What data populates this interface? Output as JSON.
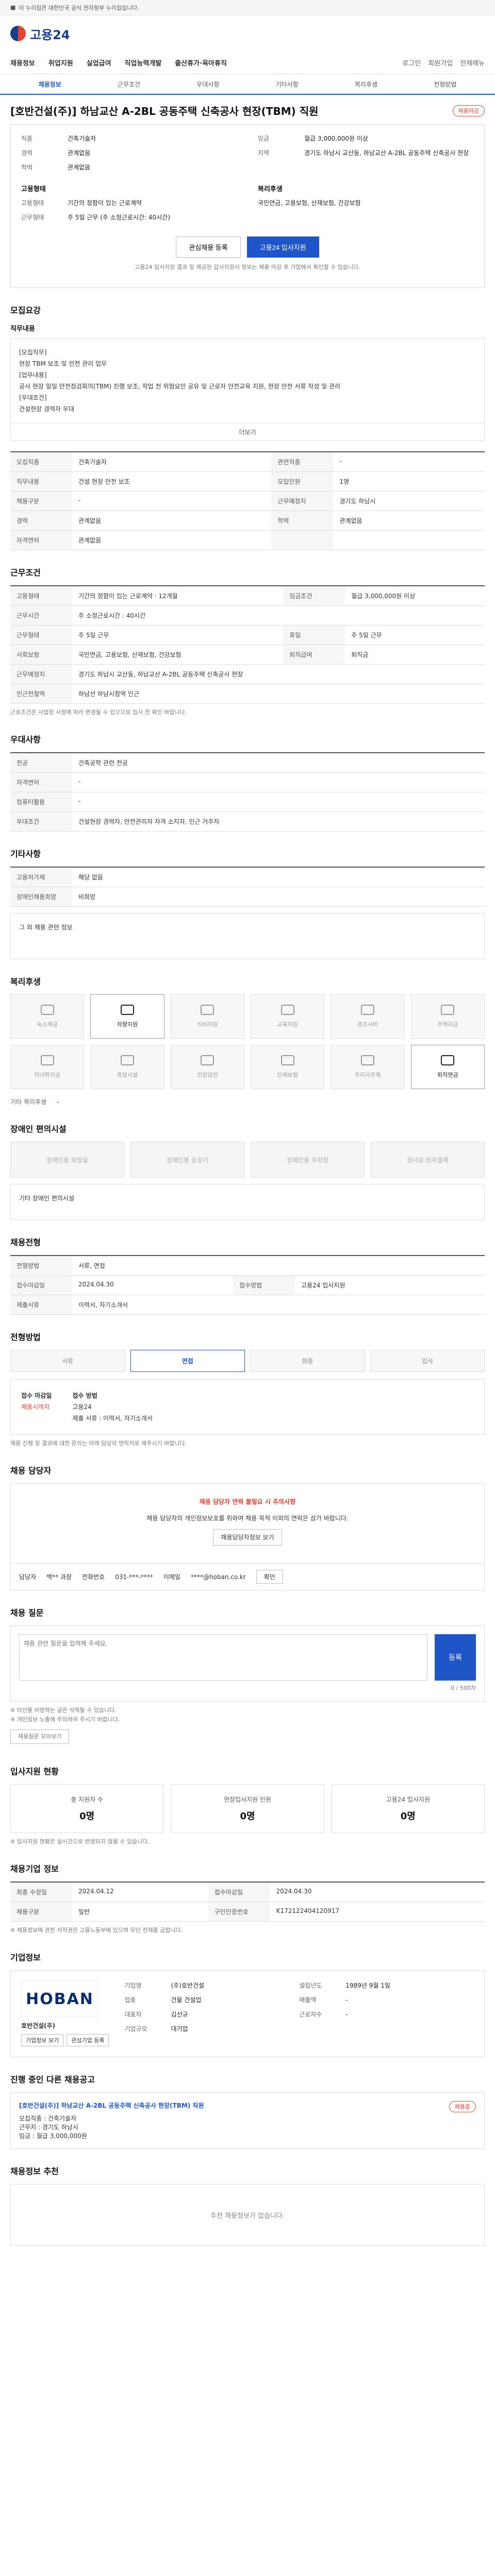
{
  "topbar": {
    "notice": "이 누리집은 대한민국 공식 전자정부 누리집입니다."
  },
  "header": {
    "logo_text": "고용24"
  },
  "gnb": {
    "items": [
      "채용정보",
      "취업지원",
      "실업급여",
      "직업능력개발",
      "출산휴가·육아휴직"
    ],
    "login": "로그인",
    "join": "회원가입",
    "menu": "전체메뉴"
  },
  "subtabs": [
    "채용정보",
    "근무조건",
    "우대사항",
    "기타사항",
    "복리후생",
    "전형방법"
  ],
  "job": {
    "title": "[호반건설(주)] 하남교산 A-2BL 공동주택 신축공사 현장(TBM) 직원",
    "badge": "채용마감",
    "left": [
      {
        "k": "직종",
        "v": "건축기술자"
      },
      {
        "k": "경력",
        "v": "관계없음"
      },
      {
        "k": "학력",
        "v": "관계없음"
      }
    ],
    "right": [
      {
        "k": "임금",
        "v": "월급 3,000,000원 이상"
      },
      {
        "k": "지역",
        "v": "경기도 하남시 교산동, 하남교산 A-2BL 공동주택 신축공사 현장"
      }
    ],
    "cond_title": "고용형태",
    "cond": [
      {
        "k": "고용형태",
        "v": "기간의 정함이 있는 근로계약"
      },
      {
        "k": "근무형태",
        "v": "주 5일 근무 (주 소정근로시간: 40시간)"
      }
    ],
    "benefit_title": "복리후생",
    "benefit": "국민연금, 고용보험, 산재보험, 건강보험",
    "scrap": "관심채용 등록",
    "apply": "고용24 입사지원",
    "note": "고용24 입사지원 결과 및 제공된 입사지원서 정보는 채용 마감 후 기업에서 확인할 수 있습니다."
  },
  "recruit": {
    "sec": "모집요강",
    "desc_title": "직무내용",
    "desc": "[모집직무]\n현장 TBM 보조 및 안전 관리 업무\n[업무내용]\n공사 현장 일일 안전점검회의(TBM) 진행 보조, 작업 전 위험요인 공유 및 근로자 안전교육 지원, 현장 안전 서류 작성 및 관리\n[우대조건]\n건설현장 경력자 우대",
    "more": "더보기",
    "rows": [
      {
        "k": "모집직종",
        "v": "건축기술자",
        "k2": "관련직종",
        "v2": "-"
      },
      {
        "k": "직무내용",
        "v": "건설 현장 안전 보조",
        "k2": "모집인원",
        "v2": "1명"
      },
      {
        "k": "채용구분",
        "v": "-",
        "k2": "근무예정지",
        "v2": "경기도 하남시"
      },
      {
        "k": "경력",
        "v": "관계없음",
        "k2": "학력",
        "v2": "관계없음"
      },
      {
        "k": "자격면허",
        "v": "관계없음",
        "k2": "",
        "v2": ""
      }
    ]
  },
  "work": {
    "sec": "근무조건",
    "rows": [
      {
        "k": "고용형태",
        "v": "기간의 정함이 있는 근로계약 · 12개월",
        "k2": "임금조건",
        "v2": "월급 3,000,000원 이상"
      },
      {
        "k": "근무시간",
        "v": "주 소정근로시간 : 40시간",
        "k2": "",
        "v2": ""
      },
      {
        "k": "근무형태",
        "v": "주 5일 근무",
        "k2": "휴일",
        "v2": "주 5일 근무"
      },
      {
        "k": "사회보험",
        "v": "국민연금, 고용보험, 산재보험, 건강보험",
        "k2": "퇴직급여",
        "v2": "퇴직금"
      },
      {
        "k": "근무예정지",
        "v": "경기도 하남시 교산동, 하남교산 A-2BL 공동주택 신축공사 현장",
        "k2": "",
        "v2": ""
      },
      {
        "k": "인근전철역",
        "v": "하남선 하남시청역 인근",
        "k2": "",
        "v2": ""
      }
    ],
    "note": "근로조건은 사업장 사정에 따라 변경될 수 있으므로 입사 전 확인 바랍니다."
  },
  "prefer": {
    "sec": "우대사항",
    "rows": [
      {
        "k": "전공",
        "v": "건축공학 관련 전공"
      },
      {
        "k": "자격면허",
        "v": "-"
      },
      {
        "k": "컴퓨터활용",
        "v": "-"
      },
      {
        "k": "우대조건",
        "v": "건설현장 경력자, 안전관리자 자격 소지자, 인근 거주자"
      }
    ]
  },
  "etc": {
    "sec": "기타사항",
    "rows": [
      {
        "k": "고용허가제",
        "v": "해당 없음"
      },
      {
        "k": "장애인채용희망",
        "v": "비희망"
      }
    ],
    "extra": "그 외 채용 관련 정보"
  },
  "welfare": {
    "sec": "복리후생",
    "items": [
      {
        "label": "숙소제공",
        "on": false
      },
      {
        "label": "차량지원",
        "on": true
      },
      {
        "label": "식비지원",
        "on": false
      },
      {
        "label": "교육지원",
        "on": false
      },
      {
        "label": "경조사비",
        "on": false
      },
      {
        "label": "주택자금",
        "on": false
      },
      {
        "label": "자녀학자금",
        "on": false
      },
      {
        "label": "휴양시설",
        "on": false
      },
      {
        "label": "건강검진",
        "on": false
      },
      {
        "label": "단체보험",
        "on": false
      },
      {
        "label": "우리사주제",
        "on": false
      },
      {
        "label": "퇴직연금",
        "on": true
      }
    ],
    "etc_label": "기타 복리후생",
    "etc_value": "-"
  },
  "disability": {
    "sec": "장애인 편의시설",
    "items": [
      "장애인용 화장실",
      "장애인용 승강기",
      "장애인용 주차장",
      "경사로·점자블록"
    ],
    "note": "기타 장애인 편의시설"
  },
  "hire": {
    "sec": "채용전형",
    "rows": [
      {
        "k": "전형방법",
        "v": "서류, 면접",
        "k2": "",
        "v2": ""
      },
      {
        "k": "접수마감일",
        "v": "2024.04.30",
        "k2": "접수방법",
        "v2": "고용24 입사지원"
      },
      {
        "k": "제출서류",
        "v": "이력서, 자기소개서",
        "k2": "",
        "v2": ""
      }
    ]
  },
  "process": {
    "sec": "전형방법",
    "steps": [
      "서류",
      "면접",
      "최종",
      "입사"
    ],
    "apply_title": "접수 마감일",
    "apply_value": "채용시까지",
    "method_title": "접수 방법",
    "method_value": "고용24",
    "docs": "제출 서류 : 이력서, 자기소개서",
    "note": "채용 진행 및 결과에 대한 문의는 아래 담당자 연락처로 해주시기 바랍니다."
  },
  "contact": {
    "sec": "채용 담당자",
    "warn": "채용 담당자 연락 불필요 시 주의사항",
    "text": "채용 담당자의 개인정보보호를 위하여 채용 목적 이외의 연락은 삼가 바랍니다.",
    "btn": "채용담당자정보 보기",
    "name_label": "담당자",
    "name": "백** 과장",
    "tel_label": "전화번호",
    "tel": "031-***-****",
    "email_label": "이메일",
    "email": "****@hoban.co.kr",
    "confirm": "확인"
  },
  "comment": {
    "sec": "채용 질문",
    "placeholder": "채용 관련 질문을 입력해 주세요.",
    "count": "0 / 500자",
    "submit": "등록",
    "notes": [
      "※ 타인을 비방하는 글은 삭제될 수 있습니다.",
      "※ 개인정보 노출에 주의하여 주시기 바랍니다."
    ],
    "more_btn": "채용질문 모아보기"
  },
  "status": {
    "sec": "입사지원 현황",
    "items": [
      {
        "label": "총 지원자 수",
        "value": "0명"
      },
      {
        "label": "현장입사지원 인원",
        "value": "0명"
      },
      {
        "label": "고용24 입사지원",
        "value": "0명"
      }
    ],
    "note": "※ 입사지원 현황은 실시간으로 반영되지 않을 수 있습니다."
  },
  "info": {
    "sec": "채용기업 정보",
    "rows": [
      {
        "k": "최종 수정일",
        "v": "2024.04.12",
        "k2": "접수마감일",
        "v2": "2024.04.30"
      },
      {
        "k": "채용구분",
        "v": "일반",
        "k2": "구인인증번호",
        "v2": "K172122404120917"
      }
    ],
    "note": "※ 채용정보에 관한 저작권은 고용노동부에 있으며 무단 전재를 금합니다."
  },
  "company": {
    "sec": "기업정보",
    "logo": "HOBAN",
    "name": "호반건설(주)",
    "rows": [
      {
        "k": "기업명",
        "v": "(주)호반건설",
        "k2": "설립년도",
        "v2": "1989년 9월 1일"
      },
      {
        "k": "업종",
        "v": "건물 건설업",
        "k2": "매출액",
        "v2": "-"
      },
      {
        "k": "대표자",
        "v": "김선규",
        "k2": "근로자수",
        "v2": "-"
      },
      {
        "k": "기업규모",
        "v": "대기업",
        "k2": "",
        "v2": ""
      }
    ],
    "btn1": "기업정보 보기",
    "btn2": "관심기업 등록"
  },
  "other": {
    "sec": "진행 중인 다른 채용공고",
    "title": "[호반건설(주)] 하남교산 A-2BL 공동주택 신축공사 현장(TBM) 직원",
    "items": [
      "모집직종 : 건축기술자",
      "근무지 : 경기도 하남시",
      "임금 : 월급 3,000,000원"
    ],
    "badge": "채용중"
  },
  "recommend": {
    "sec": "채용정보 추천",
    "empty": "추천 채용정보가 없습니다."
  }
}
